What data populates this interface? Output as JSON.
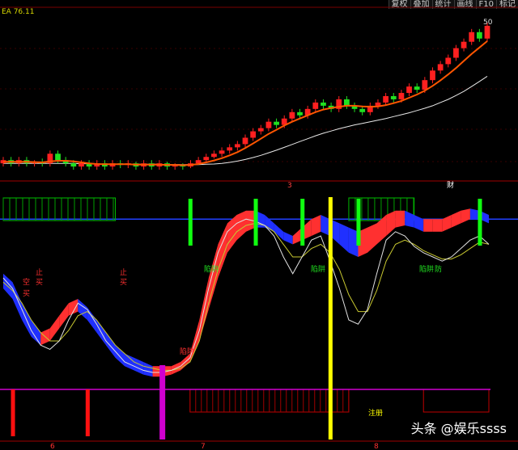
{
  "header": {
    "indicator_text": "EA  76.11"
  },
  "toolbar": {
    "buttons": [
      "复权",
      "叠加",
      "统计",
      "画线",
      "F10",
      "标记"
    ]
  },
  "watermark": "头条 @娱乐ssss",
  "chart_data": [
    {
      "type": "candlestick",
      "panel": "price",
      "title": "",
      "annotations": [
        "财",
        "3"
      ],
      "price_high_label": "50",
      "candles": [
        {
          "o": 42,
          "c": 43,
          "h": 44,
          "l": 41
        },
        {
          "o": 43,
          "c": 42,
          "h": 44,
          "l": 41
        },
        {
          "o": 42,
          "c": 43,
          "h": 44,
          "l": 41
        },
        {
          "o": 43,
          "c": 42,
          "h": 44,
          "l": 41
        },
        {
          "o": 42,
          "c": 42.5,
          "h": 43,
          "l": 41
        },
        {
          "o": 42.5,
          "c": 42,
          "h": 43.5,
          "l": 41
        },
        {
          "o": 42,
          "c": 45,
          "h": 46,
          "l": 41
        },
        {
          "o": 45,
          "c": 43,
          "h": 46,
          "l": 42
        },
        {
          "o": 43,
          "c": 42,
          "h": 44,
          "l": 41
        },
        {
          "o": 42,
          "c": 41,
          "h": 43,
          "l": 40
        },
        {
          "o": 41,
          "c": 42,
          "h": 43,
          "l": 40
        },
        {
          "o": 42,
          "c": 41,
          "h": 43,
          "l": 40
        },
        {
          "o": 41,
          "c": 42,
          "h": 43,
          "l": 40
        },
        {
          "o": 42,
          "c": 41,
          "h": 43,
          "l": 40
        },
        {
          "o": 41,
          "c": 42,
          "h": 43,
          "l": 40
        },
        {
          "o": 42,
          "c": 41.5,
          "h": 43,
          "l": 40.5
        },
        {
          "o": 41.5,
          "c": 42,
          "h": 43,
          "l": 40.5
        },
        {
          "o": 42,
          "c": 41,
          "h": 42.5,
          "l": 40
        },
        {
          "o": 41,
          "c": 42,
          "h": 43,
          "l": 40
        },
        {
          "o": 42,
          "c": 41,
          "h": 43,
          "l": 40
        },
        {
          "o": 41,
          "c": 42,
          "h": 43,
          "l": 40
        },
        {
          "o": 42,
          "c": 41,
          "h": 42.5,
          "l": 40
        },
        {
          "o": 41,
          "c": 41.5,
          "h": 42,
          "l": 40
        },
        {
          "o": 41.5,
          "c": 41,
          "h": 42,
          "l": 40
        },
        {
          "o": 41,
          "c": 42,
          "h": 43,
          "l": 40.5
        },
        {
          "o": 42,
          "c": 43,
          "h": 44,
          "l": 41.5
        },
        {
          "o": 43,
          "c": 44,
          "h": 45,
          "l": 42.5
        },
        {
          "o": 44,
          "c": 45,
          "h": 46,
          "l": 43.5
        },
        {
          "o": 45,
          "c": 46,
          "h": 47,
          "l": 44
        },
        {
          "o": 46,
          "c": 47,
          "h": 48,
          "l": 45
        },
        {
          "o": 47,
          "c": 48,
          "h": 49,
          "l": 46
        },
        {
          "o": 48,
          "c": 50,
          "h": 51,
          "l": 47
        },
        {
          "o": 50,
          "c": 52,
          "h": 53,
          "l": 49
        },
        {
          "o": 52,
          "c": 53,
          "h": 54,
          "l": 51
        },
        {
          "o": 53,
          "c": 55,
          "h": 56,
          "l": 52
        },
        {
          "o": 55,
          "c": 54,
          "h": 56,
          "l": 53
        },
        {
          "o": 54,
          "c": 56,
          "h": 57,
          "l": 53
        },
        {
          "o": 56,
          "c": 58,
          "h": 59,
          "l": 55
        },
        {
          "o": 58,
          "c": 57,
          "h": 59,
          "l": 56
        },
        {
          "o": 57,
          "c": 59,
          "h": 60,
          "l": 56
        },
        {
          "o": 59,
          "c": 61,
          "h": 62,
          "l": 58
        },
        {
          "o": 61,
          "c": 60,
          "h": 62,
          "l": 59
        },
        {
          "o": 60,
          "c": 59,
          "h": 61,
          "l": 58
        },
        {
          "o": 59,
          "c": 62,
          "h": 63,
          "l": 58
        },
        {
          "o": 62,
          "c": 60,
          "h": 63,
          "l": 59
        },
        {
          "o": 60,
          "c": 59,
          "h": 61,
          "l": 58
        },
        {
          "o": 59,
          "c": 58,
          "h": 60,
          "l": 57
        },
        {
          "o": 58,
          "c": 60,
          "h": 61,
          "l": 57
        },
        {
          "o": 60,
          "c": 61,
          "h": 62,
          "l": 59
        },
        {
          "o": 61,
          "c": 63,
          "h": 64,
          "l": 60
        },
        {
          "o": 63,
          "c": 62,
          "h": 64,
          "l": 61
        },
        {
          "o": 62,
          "c": 64,
          "h": 65,
          "l": 61
        },
        {
          "o": 64,
          "c": 66,
          "h": 67,
          "l": 63
        },
        {
          "o": 66,
          "c": 65,
          "h": 67,
          "l": 64
        },
        {
          "o": 65,
          "c": 68,
          "h": 69,
          "l": 64
        },
        {
          "o": 68,
          "c": 71,
          "h": 72,
          "l": 67
        },
        {
          "o": 71,
          "c": 73,
          "h": 74,
          "l": 70
        },
        {
          "o": 73,
          "c": 75,
          "h": 76,
          "l": 72
        },
        {
          "o": 75,
          "c": 78,
          "h": 79,
          "l": 74
        },
        {
          "o": 78,
          "c": 80,
          "h": 81,
          "l": 77
        },
        {
          "o": 80,
          "c": 83,
          "h": 84,
          "l": 79
        },
        {
          "o": 83,
          "c": 81,
          "h": 84,
          "l": 80
        },
        {
          "o": 81,
          "c": 85,
          "h": 86,
          "l": 80
        }
      ],
      "ma_fast": [
        42.5,
        42.5,
        42.5,
        42.5,
        42.4,
        42.3,
        42.6,
        42.8,
        42.8,
        42.6,
        42.3,
        42.0,
        41.8,
        41.7,
        41.7,
        41.7,
        41.7,
        41.6,
        41.6,
        41.6,
        41.6,
        41.5,
        41.5,
        41.4,
        41.5,
        41.8,
        42.3,
        42.9,
        43.6,
        44.5,
        45.5,
        46.8,
        48.2,
        49.7,
        51.2,
        52.5,
        53.8,
        55.0,
        56.0,
        57.0,
        58.0,
        58.8,
        59.3,
        59.7,
        60.0,
        60.0,
        59.8,
        59.7,
        59.8,
        60.2,
        60.8,
        61.5,
        62.5,
        63.5,
        64.7,
        66.2,
        67.9,
        69.8,
        71.8,
        74.0,
        76.2,
        78.2,
        80.2
      ],
      "ma_slow": [
        42.0,
        42.0,
        42.0,
        42.0,
        42.0,
        42.0,
        42.0,
        42.0,
        42.0,
        42.0,
        41.9,
        41.9,
        41.8,
        41.8,
        41.8,
        41.8,
        41.7,
        41.7,
        41.7,
        41.7,
        41.7,
        41.6,
        41.6,
        41.6,
        41.6,
        41.6,
        41.7,
        41.8,
        42.0,
        42.3,
        42.7,
        43.2,
        43.8,
        44.5,
        45.3,
        46.1,
        47.0,
        47.9,
        48.8,
        49.7,
        50.6,
        51.4,
        52.1,
        52.8,
        53.4,
        54.0,
        54.5,
        55.0,
        55.5,
        56.0,
        56.6,
        57.2,
        57.8,
        58.5,
        59.2,
        60.0,
        61.0,
        62.0,
        63.2,
        64.5,
        66.0,
        67.6,
        69.2
      ]
    },
    {
      "type": "indicator",
      "panel": "oscillator",
      "labels": [
        "止",
        "买",
        "空",
        "买",
        "止",
        "买",
        "陷阱",
        "陷阱",
        "陷阱",
        "陷阱",
        "防",
        "注册"
      ],
      "line_white": [
        60,
        55,
        45,
        35,
        28,
        26,
        30,
        40,
        48,
        45,
        38,
        30,
        25,
        20,
        18,
        16,
        15,
        15,
        16,
        18,
        22,
        35,
        55,
        72,
        82,
        86,
        88,
        87,
        85,
        80,
        70,
        62,
        70,
        78,
        80,
        68,
        55,
        40,
        38,
        45,
        62,
        78,
        82,
        80,
        75,
        72,
        70,
        68,
        70,
        74,
        78,
        80,
        76
      ],
      "line_yellow": [
        58,
        54,
        48,
        40,
        34,
        30,
        30,
        35,
        42,
        44,
        40,
        34,
        28,
        24,
        20,
        18,
        17,
        16,
        16,
        17,
        20,
        30,
        48,
        64,
        76,
        82,
        85,
        86,
        85,
        82,
        76,
        70,
        70,
        74,
        76,
        72,
        64,
        52,
        44,
        44,
        54,
        68,
        76,
        78,
        76,
        73,
        71,
        69,
        69,
        71,
        74,
        77,
        76
      ],
      "band_upper": [
        62,
        58,
        48,
        40,
        34,
        36,
        42,
        48,
        50,
        46,
        40,
        34,
        28,
        24,
        22,
        20,
        18,
        18,
        18,
        20,
        24,
        40,
        60,
        76,
        86,
        90,
        92,
        92,
        90,
        86,
        82,
        80,
        84,
        88,
        90,
        88,
        86,
        84,
        82,
        84,
        86,
        90,
        92,
        92,
        90,
        88,
        88,
        88,
        90,
        92,
        93,
        92,
        90
      ],
      "band_lower": [
        55,
        50,
        40,
        32,
        28,
        30,
        36,
        42,
        44,
        40,
        34,
        28,
        22,
        18,
        16,
        14,
        13,
        13,
        14,
        16,
        20,
        30,
        45,
        60,
        72,
        78,
        82,
        84,
        84,
        82,
        78,
        76,
        78,
        80,
        82,
        80,
        76,
        72,
        70,
        72,
        76,
        80,
        84,
        85,
        84,
        82,
        82,
        82,
        84,
        86,
        88,
        88,
        86
      ],
      "bottom_bars_x": [
        1,
        9,
        19
      ],
      "signal_bars_x": [
        20,
        27,
        32,
        38,
        51
      ]
    }
  ],
  "x_axis_labels": [
    "6",
    "7",
    "8"
  ],
  "colors": {
    "up": "#ff2020",
    "down": "#20e020",
    "ma_fast": "#ff5500",
    "ma_slow": "#e8e8e8",
    "separator": "#a00000",
    "blue_line": "#2040ff",
    "yellow": "#ffff00",
    "magenta": "#d000d0"
  }
}
